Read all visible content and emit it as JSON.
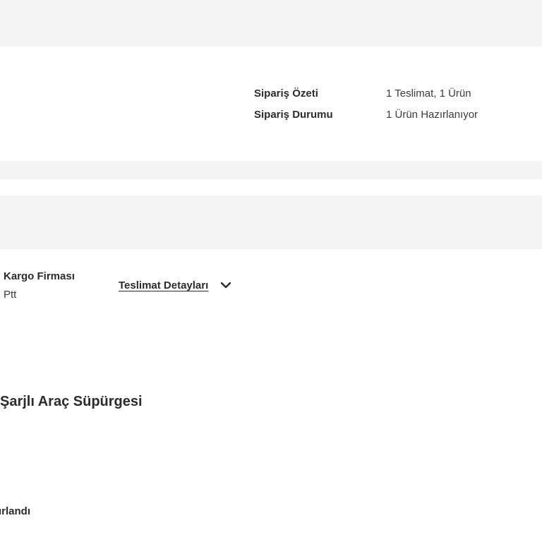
{
  "order_summary": {
    "summary_label": "Sipariş Özeti",
    "summary_value": "1 Teslimat, 1 Ürün",
    "status_label": "Sipariş Durumu",
    "status_value": "1 Ürün Hazırlanıyor"
  },
  "shipment": {
    "cargo_label": "Kargo Firması",
    "cargo_value": "Ptt",
    "details_link": "Teslimat Detayları",
    "chevron_icon": "chevron-down-icon"
  },
  "product": {
    "title": "Şarjlı Araç Süpürgesi",
    "status_fragment": "ırlandı"
  }
}
